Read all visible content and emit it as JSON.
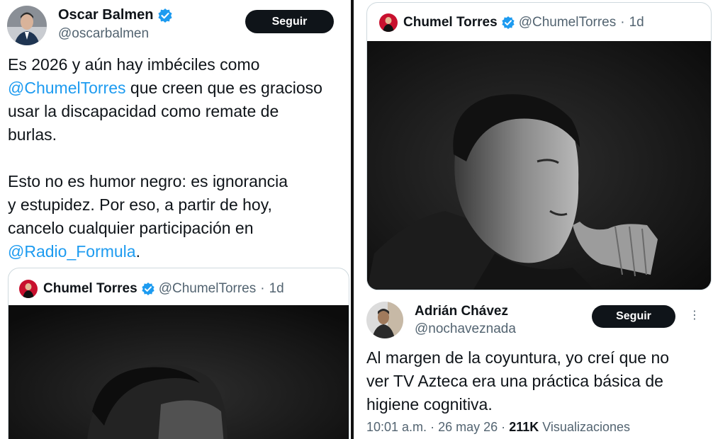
{
  "left": {
    "author": {
      "name": "Oscar Balmen",
      "handle": "@oscarbalmen",
      "verified": true,
      "avatar_icon": "person-avatar-icon"
    },
    "follow_label": "Seguir",
    "text": {
      "line1": "Es 2026 y aún hay imbéciles como",
      "mention1": "@ChumelTorres",
      "line2_rest": " que creen que es gracioso",
      "line3": "usar la discapacidad como remate de",
      "line4": "burlas.",
      "line5": "Esto no es humor negro: es ignorancia",
      "line6": "y estupidez. Por eso, a partir de hoy,",
      "line7": "cancelo cualquier participación en",
      "mention2": "@Radio_Formula",
      "line8_rest": "."
    },
    "quote": {
      "name": "Chumel Torres",
      "handle": "@ChumelTorres",
      "separator": "·",
      "age": "1d"
    }
  },
  "right": {
    "quote": {
      "name": "Chumel Torres",
      "handle": "@ChumelTorres",
      "separator": "·",
      "age": "1d"
    },
    "reply": {
      "author": {
        "name": "Adrián Chávez",
        "handle": "@nochaveznada",
        "avatar_icon": "person-avatar-icon"
      },
      "follow_label": "Seguir",
      "text": {
        "line1": "Al margen de la coyuntura, yo creí que no",
        "line2": "ver TV Azteca era una práctica básica de",
        "line3": "higiene cognitiva."
      },
      "time": "10:01 a.m.",
      "separator": "·",
      "date": "26 may 26",
      "separator2": "·",
      "views_count": "211K",
      "views_label": "Visualizaciones"
    }
  },
  "colors": {
    "mention": "#1d9bf0",
    "verified": "#1d9bf0",
    "follow_button": "#0f1419",
    "secondary_text": "#536471"
  }
}
